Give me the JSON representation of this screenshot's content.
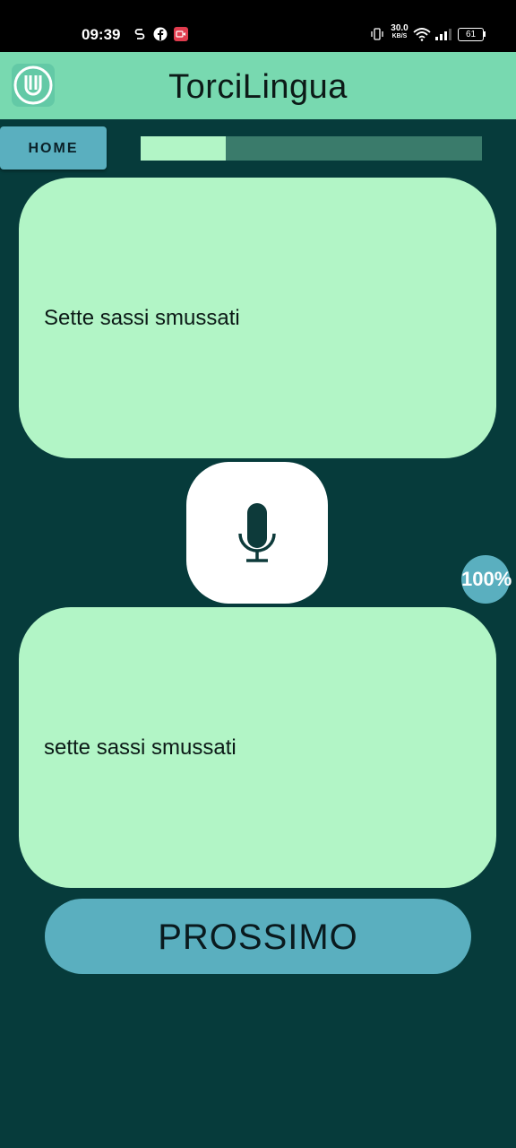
{
  "status_bar": {
    "time": "09:39",
    "network_speed": "30.0",
    "network_unit": "KB/S",
    "battery": "61",
    "left_icons": [
      "s-icon",
      "facebook-icon",
      "video-icon"
    ],
    "right_icons": [
      "vibrate-icon",
      "wifi-icon",
      "signal-icon",
      "battery-icon"
    ]
  },
  "app_bar": {
    "title": "TorciLingua",
    "logo_icon": "app-logo-icon"
  },
  "nav": {
    "home_label": "HOME"
  },
  "progress": {
    "value": 0.25,
    "fill_color": "#b2f5c6",
    "track_color": "#3a7b6b"
  },
  "prompt_card": {
    "text": "Sette sassi smussati"
  },
  "mic": {
    "icon": "microphone-icon"
  },
  "score": {
    "label": "100%"
  },
  "result_card": {
    "text": "sette sassi smussati"
  },
  "next_button": {
    "label": "PROSSIMO"
  },
  "colors": {
    "background": "#063b3b",
    "app_bar": "#78d9b0",
    "card": "#b2f5c6",
    "accent": "#5aafbf"
  }
}
